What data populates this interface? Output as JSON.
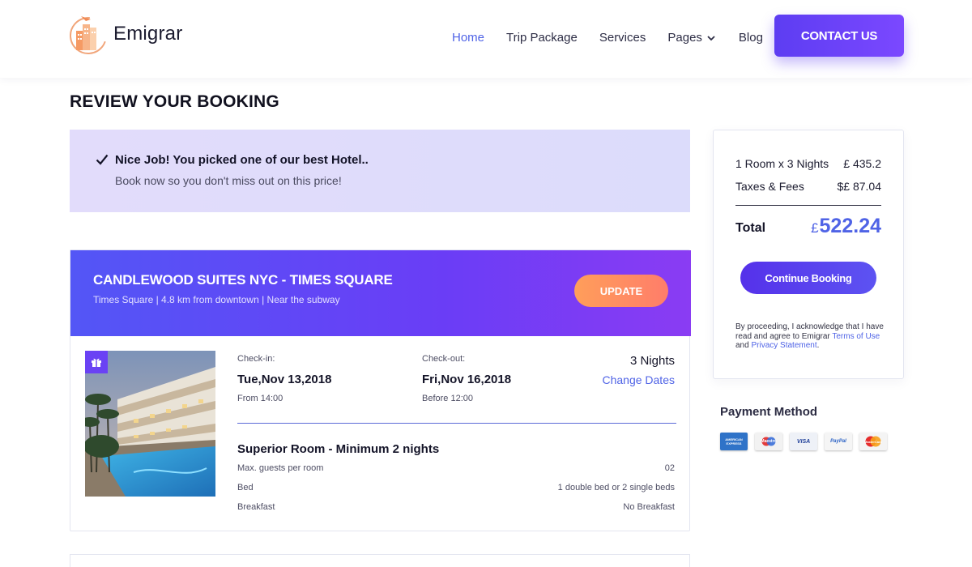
{
  "brand": {
    "name": "Emigrar",
    "accent": "#4f63e6",
    "primary": "#5d3df2"
  },
  "nav": {
    "items": [
      {
        "label": "Home",
        "active": true
      },
      {
        "label": "Trip Package"
      },
      {
        "label": "Services"
      },
      {
        "label": "Pages",
        "dropdown": true
      },
      {
        "label": "Blog"
      }
    ],
    "contact_label": "CONTACT US"
  },
  "page": {
    "title": "REVIEW YOUR BOOKING"
  },
  "notice": {
    "title": "Nice Job! You picked one of our best Hotel..",
    "subtitle": "Book now so you don't miss out on this price!"
  },
  "hotel": {
    "name": "CANDLEWOOD SUITES NYC - TIMES SQUARE",
    "location": "Times Square | 4.8 km from downtown | Near the subway",
    "update_label": "UPDATE",
    "checkin": {
      "label": "Check-in:",
      "date": "Tue,Nov 13,2018",
      "time": "From 14:00"
    },
    "checkout": {
      "label": "Check-out:",
      "date": "Fri,Nov 16,2018",
      "time": "Before 12:00"
    },
    "nights": "3 Nights",
    "change_dates": "Change Dates",
    "room": {
      "title": "Superior Room - Minimum 2 nights",
      "rows": [
        {
          "label": "Max. guests per room",
          "value": "02"
        },
        {
          "label": "Bed",
          "value": "1 double bed or 2 single beds"
        },
        {
          "label": "Breakfast",
          "value": "No Breakfast"
        }
      ]
    }
  },
  "summary": {
    "line1": {
      "label": "1 Room x 3 Nights",
      "value": "£ 435.2"
    },
    "line2": {
      "label": "Taxes & Fees",
      "value": "$£ 87.04"
    },
    "total_label": "Total",
    "total_currency": "£",
    "total_value": "522.24",
    "continue_label": "Continue Booking",
    "legal_text": "By proceeding, I acknowledge that I have read and agree to Emigrar",
    "legal_terms": "Terms of Use",
    "legal_and": "and",
    "legal_privacy": "Privacy Statement",
    "legal_end": "."
  },
  "payment": {
    "title": "Payment Method",
    "cards": [
      {
        "name": "American Express",
        "label": "AMERICAN EXPRESS",
        "icon": "amex-icon",
        "bg": "#2f73c8",
        "fg": "#ffffff"
      },
      {
        "name": "Maestro",
        "label": "Maestro",
        "icon": "maestro-icon",
        "bg": "#f2f2f2",
        "fg": "#1f56b3"
      },
      {
        "name": "Visa",
        "label": "VISA",
        "icon": "visa-icon",
        "bg": "#eef1f7",
        "fg": "#1f3f99"
      },
      {
        "name": "PayPal",
        "label": "PayPal",
        "icon": "paypal-icon",
        "bg": "#f5f5f5",
        "fg": "#2c63c6"
      },
      {
        "name": "MasterCard",
        "label": "MasterCard",
        "icon": "mastercard-icon",
        "bg": "#f4f4f4",
        "fg": "#ffffff"
      }
    ]
  }
}
